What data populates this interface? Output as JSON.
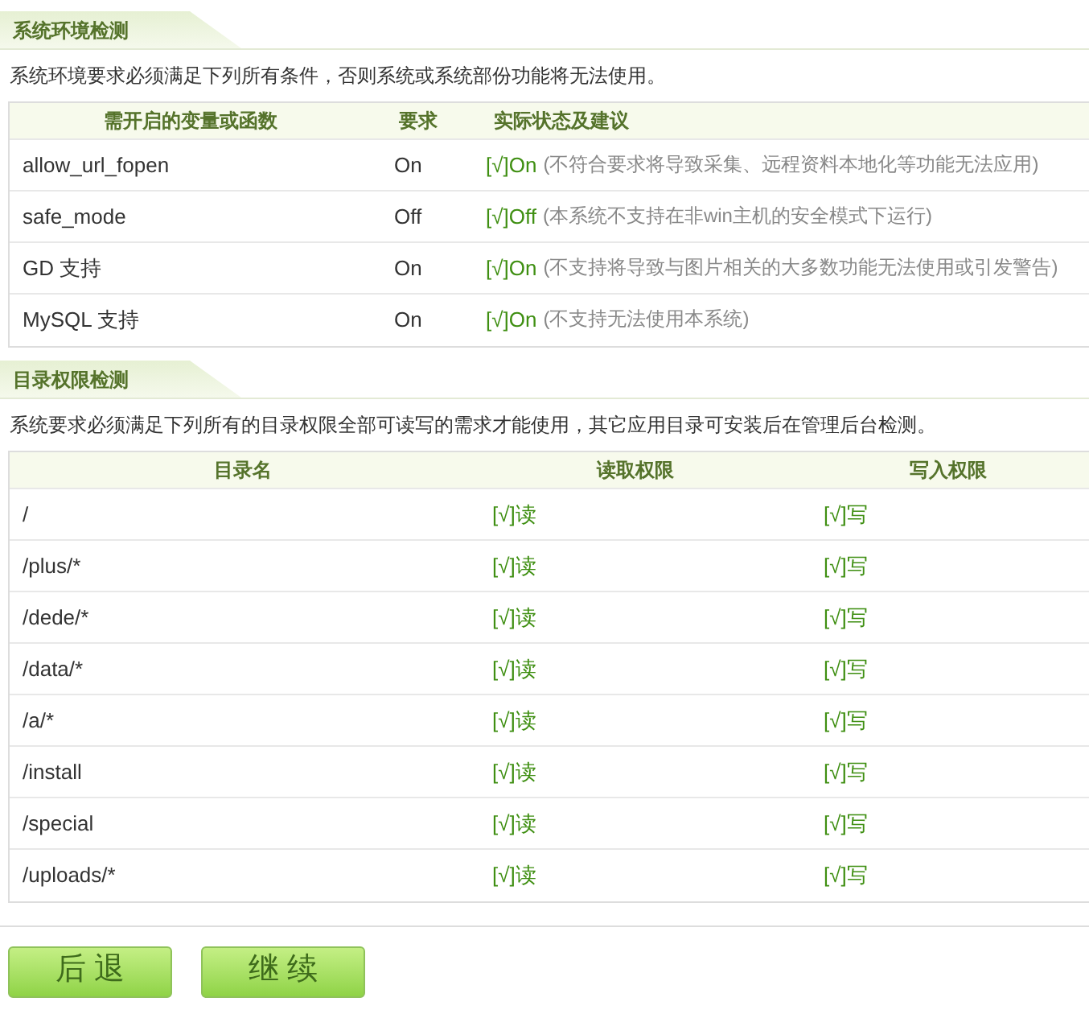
{
  "env_section": {
    "title": "系统环境检测",
    "description": "系统环境要求必须满足下列所有条件，否则系统或系统部份功能将无法使用。",
    "columns": [
      "需开启的变量或函数",
      "要求",
      "实际状态及建议"
    ],
    "rows": [
      {
        "name": "allow_url_fopen",
        "required": "On",
        "status": "[√]On",
        "note": "(不符合要求将导致采集、远程资料本地化等功能无法应用)"
      },
      {
        "name": "safe_mode",
        "required": "Off",
        "status": "[√]Off",
        "note": "(本系统不支持在非win主机的安全模式下运行)"
      },
      {
        "name": "GD 支持",
        "required": "On",
        "status": "[√]On",
        "note": "(不支持将导致与图片相关的大多数功能无法使用或引发警告)"
      },
      {
        "name": "MySQL 支持",
        "required": "On",
        "status": "[√]On",
        "note": "(不支持无法使用本系统)"
      }
    ]
  },
  "dir_section": {
    "title": "目录权限检测",
    "description": "系统要求必须满足下列所有的目录权限全部可读写的需求才能使用，其它应用目录可安装后在管理后台检测。",
    "columns": [
      "目录名",
      "读取权限",
      "写入权限"
    ],
    "rows": [
      {
        "dir": "/",
        "read": "[√]读",
        "write": "[√]写"
      },
      {
        "dir": "/plus/*",
        "read": "[√]读",
        "write": "[√]写"
      },
      {
        "dir": "/dede/*",
        "read": "[√]读",
        "write": "[√]写"
      },
      {
        "dir": "/data/*",
        "read": "[√]读",
        "write": "[√]写"
      },
      {
        "dir": "/a/*",
        "read": "[√]读",
        "write": "[√]写"
      },
      {
        "dir": "/install",
        "read": "[√]读",
        "write": "[√]写"
      },
      {
        "dir": "/special",
        "read": "[√]读",
        "write": "[√]写"
      },
      {
        "dir": "/uploads/*",
        "read": "[√]读",
        "write": "[√]写"
      }
    ]
  },
  "buttons": [
    "后 退",
    "继 续"
  ]
}
